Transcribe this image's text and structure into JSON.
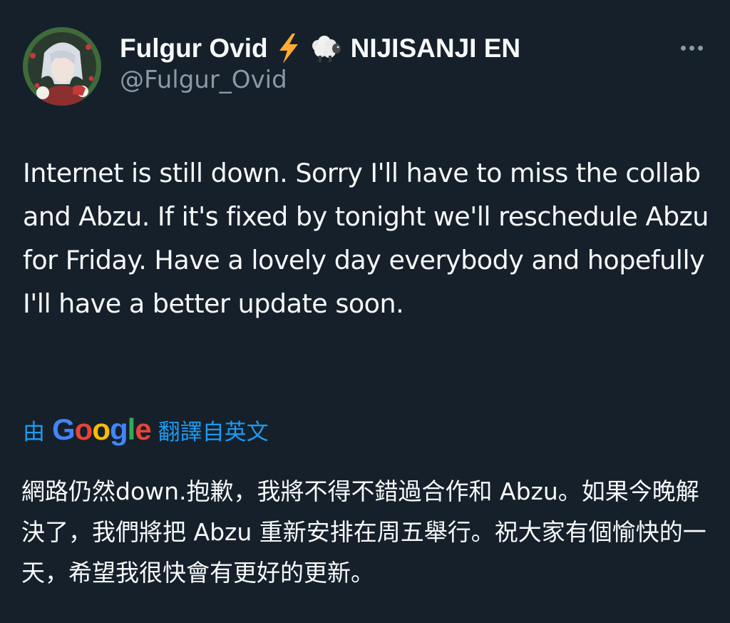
{
  "author": {
    "display_name": "Fulgur Ovid",
    "emoji_1": "lightning-emoji",
    "emoji_2": "sheep-emoji",
    "affiliation": "NIJISANJI EN",
    "handle": "@Fulgur_Ovid"
  },
  "tweet": {
    "text": "Internet is still down. Sorry I'll have to miss the collab and Abzu. If it's fixed by tonight we'll reschedule Abzu for Friday. Have a lovely day everybody and hopefully I'll have a better update soon."
  },
  "translation": {
    "prefix": "由",
    "provider": "Google",
    "suffix": "翻譯自英文",
    "text": "網路仍然down.抱歉，我將不得不錯過合作和 Abzu。如果今晚解決了，我們將把 Abzu 重新安排在周五舉行。祝大家有個愉快的一天，希望我很快會有更好的更新。"
  },
  "colors": {
    "background": "#15202b",
    "text_primary": "#f7f9f9",
    "text_secondary": "#8b98a5",
    "link": "#1d9bf0",
    "google_blue": "#4285f4",
    "google_red": "#ea4335",
    "google_yellow": "#fbbc05",
    "google_green": "#34a853"
  }
}
